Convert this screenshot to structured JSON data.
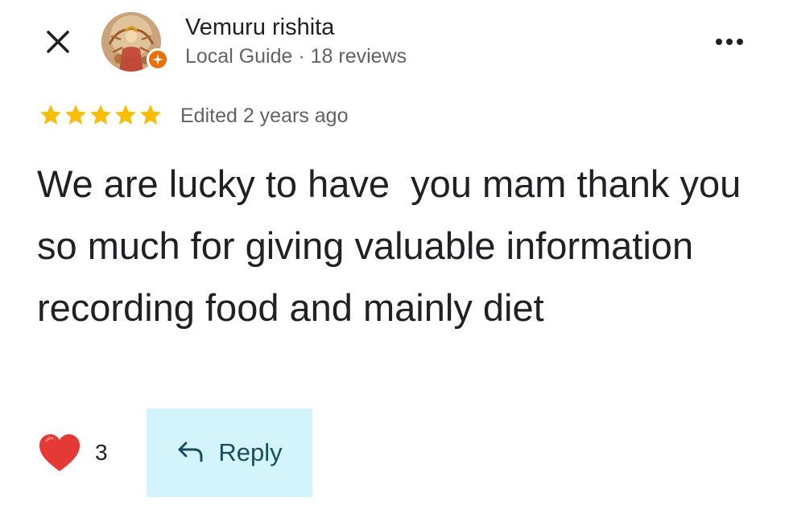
{
  "header": {
    "close_icon": "close-icon",
    "more_icon": "more-horiz-icon"
  },
  "author": {
    "name": "Vemuru rishita",
    "meta": "Local Guide · 18 reviews",
    "badge_icon": "local-guide-star-icon",
    "badge_color": "#e8710a"
  },
  "review": {
    "rating": 5,
    "max_rating": 5,
    "star_color": "#fbbc04",
    "timestamp": "Edited 2 years ago",
    "text": "We are lucky to have  you mam thank you so much for giving valuable information recording food and mainly diet"
  },
  "actions": {
    "heart_icon": "heart-icon",
    "heart_color": "#e53935",
    "like_count": "3",
    "reply_icon": "reply-arrow-icon",
    "reply_label": "Reply",
    "reply_bg": "#d3f4fb"
  }
}
